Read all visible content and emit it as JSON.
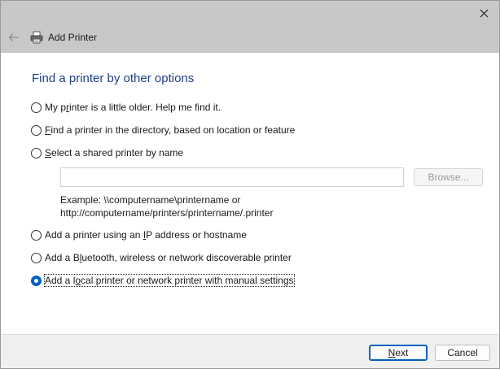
{
  "window": {
    "title": "Add Printer"
  },
  "icons": {
    "back": "back-arrow-icon",
    "close": "close-icon",
    "printer": "printer-icon"
  },
  "heading": "Find a printer by other options",
  "options": [
    {
      "pre": "My p",
      "key": "r",
      "post": "inter is a little older. Help me find it.",
      "checked": false
    },
    {
      "pre": "",
      "key": "F",
      "post": "ind a printer in the directory, based on location or feature",
      "checked": false
    },
    {
      "pre": "",
      "key": "S",
      "post": "elect a shared printer by name",
      "checked": false
    },
    {
      "pre": "Add a printer using an ",
      "key": "I",
      "post": "P address or hostname",
      "checked": false
    },
    {
      "pre": "Add a B",
      "key": "l",
      "post": "uetooth, wireless or network discoverable printer",
      "checked": false
    },
    {
      "pre": "Add a l",
      "key": "o",
      "post": "cal printer or network printer with manual settings",
      "checked": true
    }
  ],
  "shared": {
    "input_value": "",
    "browse_label": "Browse...",
    "example_line1": "Example: \\\\computername\\printername or",
    "example_line2": "http://computername/printers/printername/.printer"
  },
  "footer": {
    "next_key": "N",
    "next_rest": "ext",
    "cancel_label": "Cancel"
  },
  "colors": {
    "heading": "#1e3e86",
    "titlebar": "#c8c8c8",
    "accent": "#0060c0"
  }
}
